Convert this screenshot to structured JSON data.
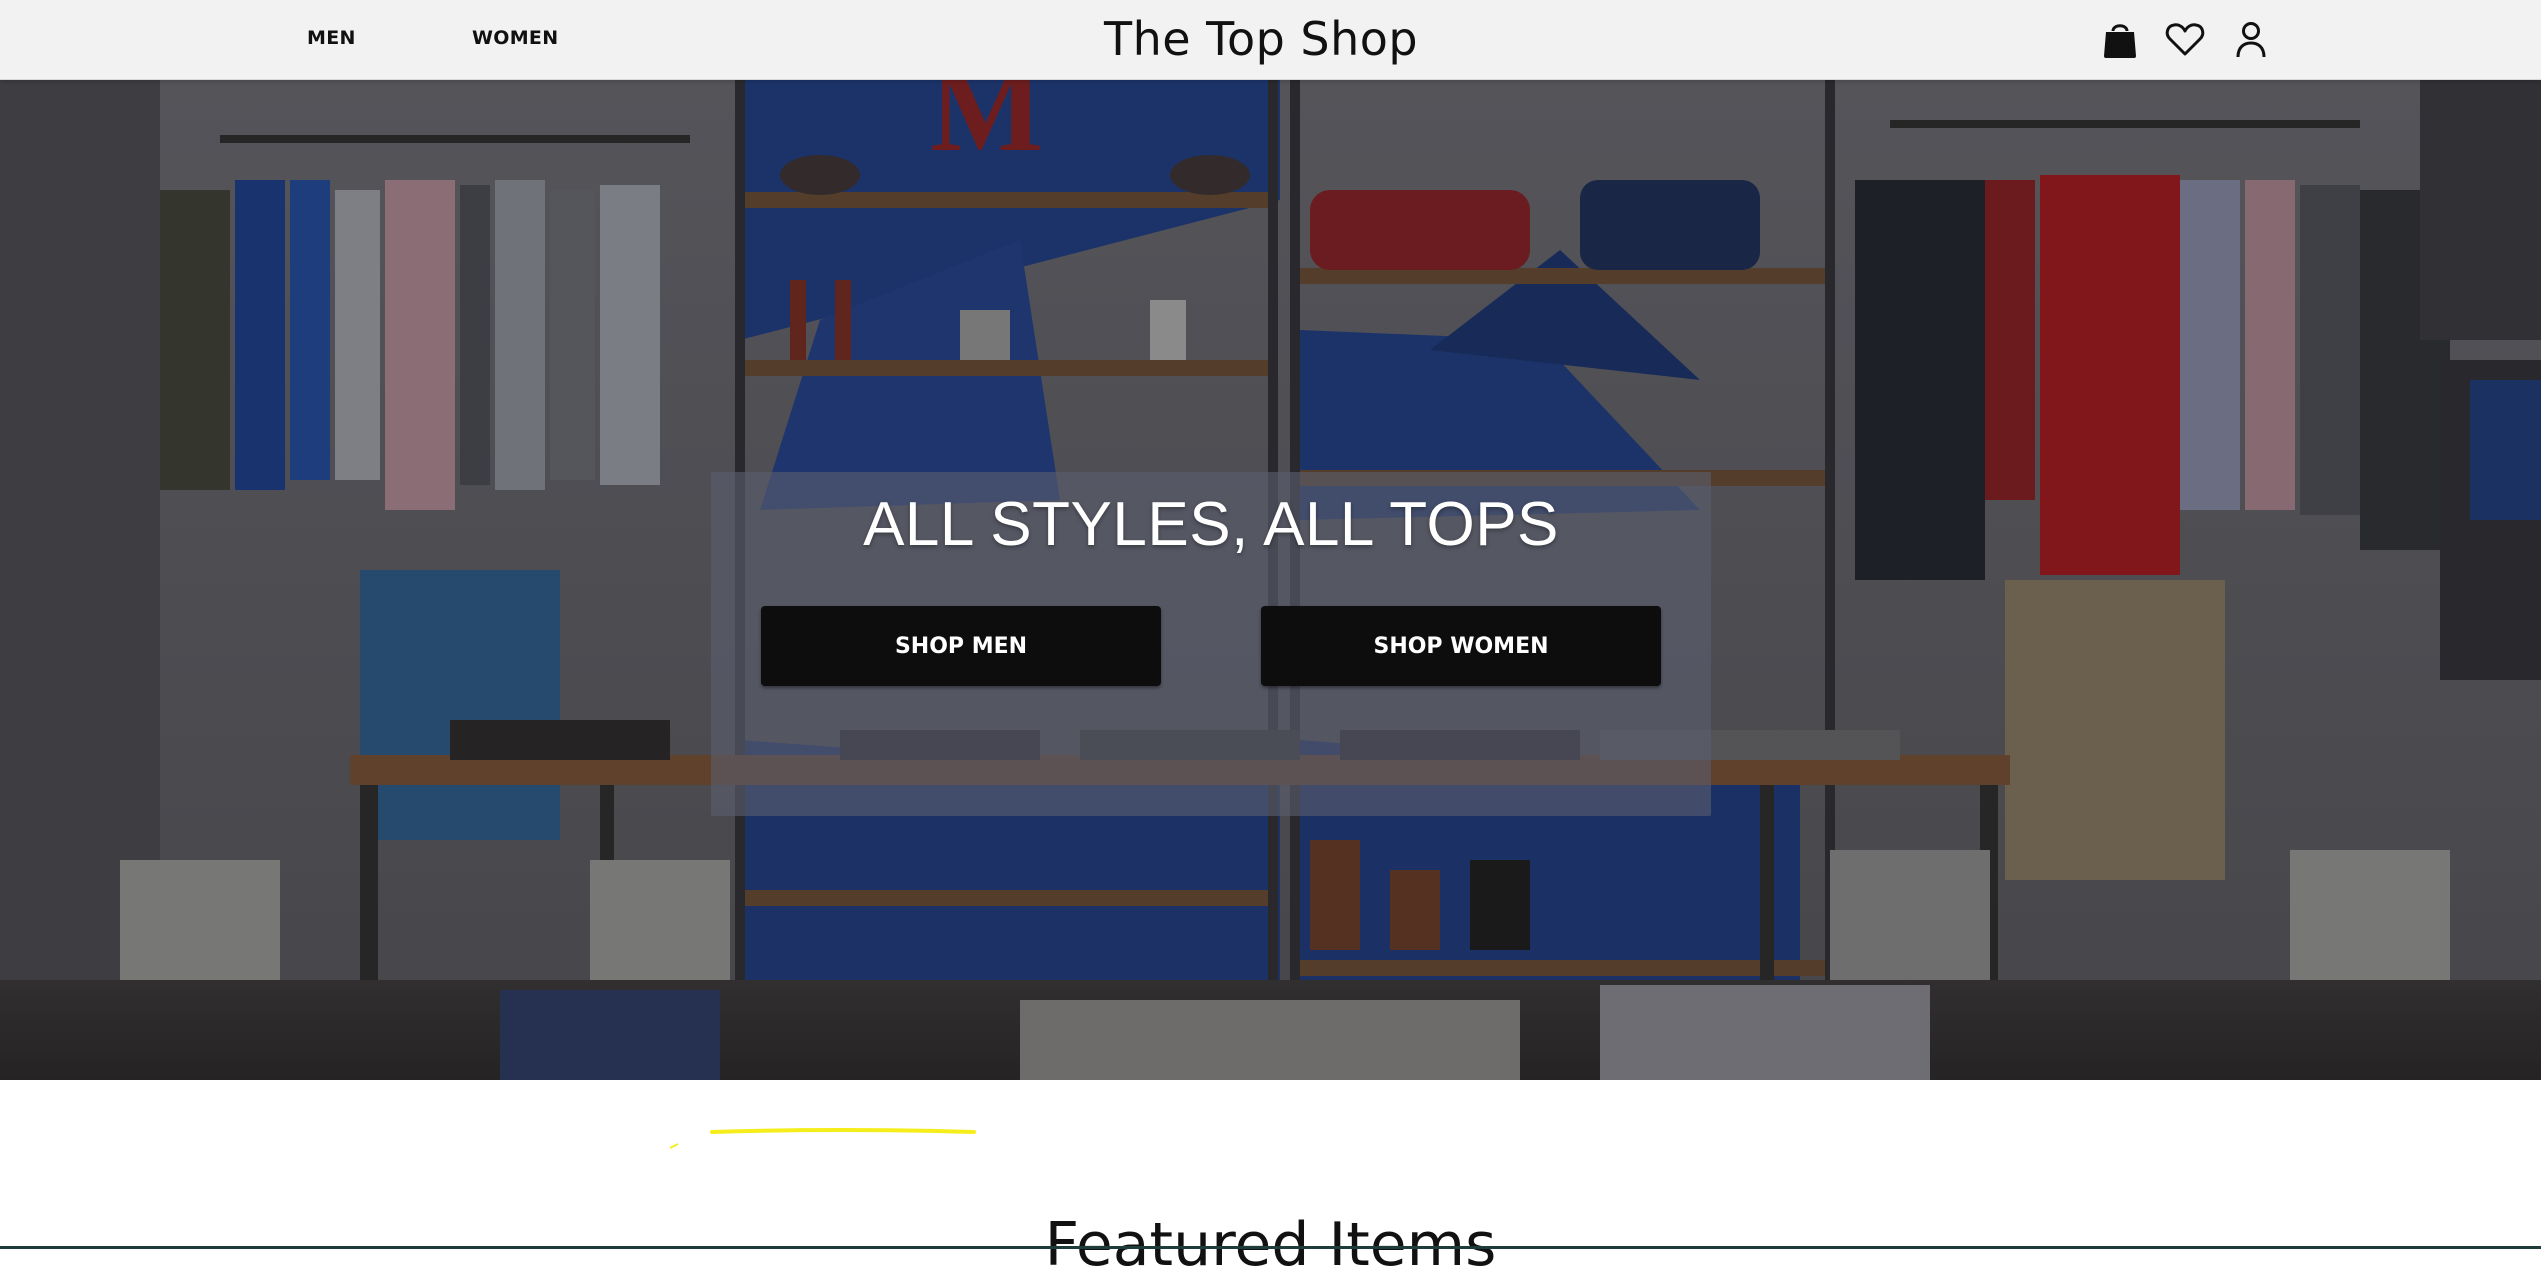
{
  "header": {
    "nav": [
      {
        "label": "MEN"
      },
      {
        "label": "WOMEN"
      }
    ],
    "title": "The Top Shop",
    "icons": [
      "shopping-bag-icon",
      "heart-icon",
      "user-icon"
    ]
  },
  "hero": {
    "heading": "ALL STYLES, ALL TOPS",
    "buttons": {
      "men": "SHOP MEN",
      "women": "SHOP WOMEN"
    },
    "background_image": "clothing store interior"
  },
  "featured": {
    "heading": "Featured Items"
  },
  "colors": {
    "header_bg": "#f2f2f2",
    "button_bg": "#0d0d0d",
    "button_text": "#ffffff",
    "panel_overlay": "rgba(90,94,110,0.62)",
    "accent_stroke": "#f5ee1a"
  }
}
